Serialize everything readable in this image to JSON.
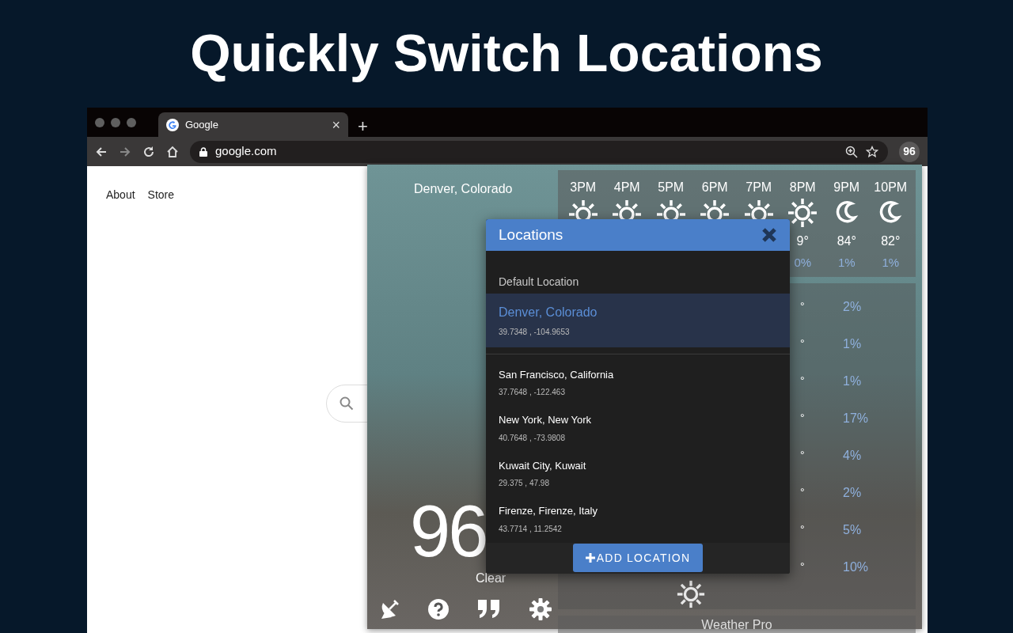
{
  "headline": "Quickly Switch Locations",
  "browser": {
    "tab": {
      "title": "Google",
      "close": "×"
    },
    "new_tab": "+",
    "address": "google.com",
    "extension_badge": "96"
  },
  "page_links": [
    "About",
    "Store"
  ],
  "weather": {
    "location": "Denver, Colorado",
    "temperature": "96",
    "condition": "Clear",
    "hourly": [
      {
        "time": "3PM",
        "kind": "sun"
      },
      {
        "time": "4PM",
        "kind": "sun"
      },
      {
        "time": "5PM",
        "kind": "sun"
      },
      {
        "time": "6PM",
        "kind": "sun"
      },
      {
        "time": "7PM",
        "kind": "sun"
      },
      {
        "time": "8PM",
        "kind": "sun",
        "temp": "9°",
        "precip": "0%"
      },
      {
        "time": "9PM",
        "kind": "moon",
        "temp": "84°",
        "precip": "1%"
      },
      {
        "time": "10PM",
        "kind": "moon",
        "temp": "82°",
        "precip": "1%"
      }
    ],
    "daily": [
      {
        "temp": "°",
        "precip": "2%"
      },
      {
        "temp": "°",
        "precip": "1%"
      },
      {
        "temp": "°",
        "precip": "1%"
      },
      {
        "temp": "°",
        "precip": "17%"
      },
      {
        "temp": "°",
        "precip": "4%"
      },
      {
        "temp": "°",
        "precip": "2%"
      },
      {
        "temp": "°",
        "precip": "5%"
      },
      {
        "temp": "°",
        "precip": "10%"
      }
    ],
    "footer": "Weather Pro"
  },
  "modal": {
    "title": "Locations",
    "section": "Default Location",
    "default_location": {
      "name": "Denver, Colorado",
      "coords": "39.7348 , -104.9653",
      "selected": true
    },
    "locations": [
      {
        "name": "San Francisco, California",
        "coords": "37.7648 , -122.463",
        "selected": false
      },
      {
        "name": "New York, New York",
        "coords": "40.7648 , -73.9808",
        "selected": false
      },
      {
        "name": "Kuwait City, Kuwait",
        "coords": "29.375 , 47.98",
        "selected": false
      },
      {
        "name": "Firenze, Firenze, Italy",
        "coords": "43.7714 , 11.2542",
        "selected": false
      }
    ],
    "add_button": "ADD LOCATION"
  }
}
